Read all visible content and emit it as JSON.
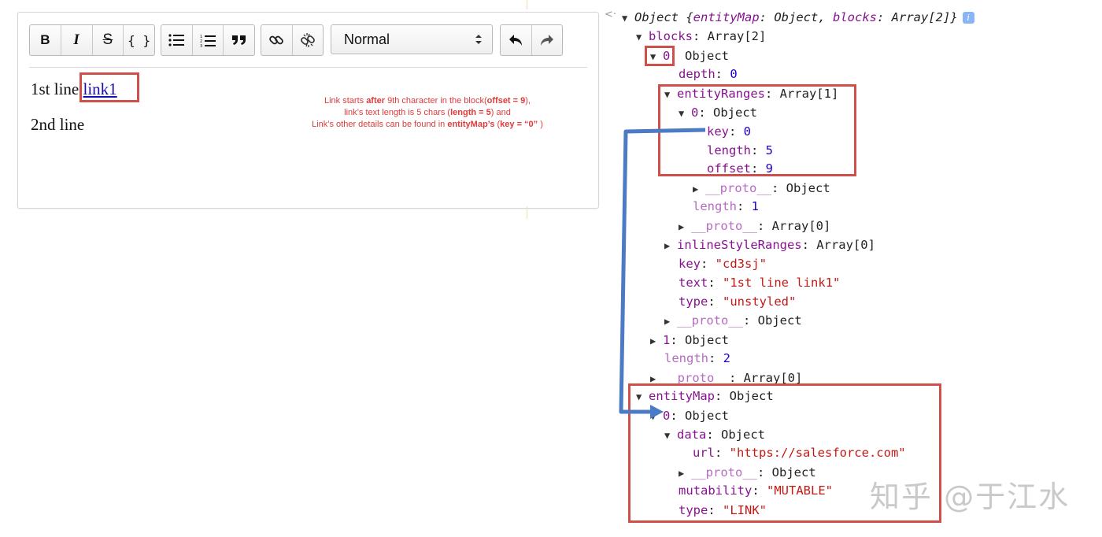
{
  "toolbar": {
    "bold": "B",
    "italic": "I",
    "strike": "S",
    "code": "{ }",
    "block_type": "Normal",
    "icons": [
      "bold-icon",
      "italic-icon",
      "strikethrough-icon",
      "code-icon",
      "unordered-list-icon",
      "ordered-list-icon",
      "blockquote-icon",
      "link-icon",
      "unlink-icon",
      "chevron-up-down-icon",
      "undo-icon",
      "redo-icon"
    ]
  },
  "editor": {
    "line1_text": "1st line ",
    "line1_link": "link1",
    "line2_text": "2nd line"
  },
  "annotation": {
    "l1_a": "Link starts ",
    "l1_b": "after",
    "l1_c": " 9th character in the block(",
    "l1_d": "offset = 9",
    "l1_e": "),",
    "l2_a": "link’s text length is 5 chars (",
    "l2_b": "length = 5",
    "l2_c": ") and",
    "l3_a": "Link’s other details can be found in ",
    "l3_b": "entityMap’s",
    "l3_c": " (",
    "l3_d": "key = “0”",
    "l3_e": " )"
  },
  "tree": {
    "root_obj": "Object ",
    "root_summary_a": "{",
    "root_k1": "entityMap",
    "root_v1": ": Object, ",
    "root_k2": "blocks",
    "root_v2": ": Array[2]}",
    "info": "i",
    "blocks_k": "blocks",
    "blocks_v": ": Array[2]",
    "b0_k": "0",
    "b0_v": ": Object",
    "depth_k": "depth",
    "depth_v": "0",
    "er_k": "entityRanges",
    "er_v": ": Array[1]",
    "er0_k": "0",
    "er0_v": ": Object",
    "er_key_k": "key",
    "er_key_v": "0",
    "er_len_k": "length",
    "er_len_v": "5",
    "er_off_k": "offset",
    "er_off_v": "9",
    "er0_proto_k": "__proto__",
    "er0_proto_v": ": Object",
    "er_length_k": "length",
    "er_length_v": "1",
    "er_proto_k": "__proto__",
    "er_proto_v": ": Array[0]",
    "isr_k": "inlineStyleRanges",
    "isr_v": ": Array[0]",
    "key_k": "key",
    "key_v": "\"cd3sj\"",
    "text_k": "text",
    "text_v": "\"1st line link1\"",
    "type_k": "type",
    "type_v": "\"unstyled\"",
    "b0_proto_k": "__proto__",
    "b0_proto_v": ": Object",
    "b1_k": "1",
    "b1_v": ": Object",
    "blen_k": "length",
    "blen_v": "2",
    "bproto_k": "__proto__",
    "bproto_v": ": Array[0]",
    "em_k": "entityMap",
    "em_v": ": Object",
    "em0_k": "0",
    "em0_v": ": Object",
    "data_k": "data",
    "data_v": ": Object",
    "url_k": "url",
    "url_v": "\"https://salesforce.com\"",
    "data_proto_k": "__proto__",
    "data_proto_v": ": Object",
    "mut_k": "mutability",
    "mut_v": "\"MUTABLE\"",
    "etype_k": "type",
    "etype_v": "\"LINK\""
  },
  "watermark": "知乎 @于江水",
  "colors": {
    "highlight_box": "#cf4f4a",
    "arrow": "#4a7bc4",
    "annotation_text": "#e03a3a"
  }
}
